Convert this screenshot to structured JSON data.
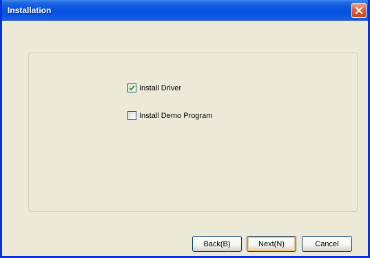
{
  "window": {
    "title": "Installation",
    "close_icon": "close-icon"
  },
  "options": [
    {
      "label": "Install Driver",
      "checked": true
    },
    {
      "label": "Install Demo Program",
      "checked": false
    }
  ],
  "buttons": {
    "back": "Back(B)",
    "next": "Next(N)",
    "cancel": "Cancel"
  },
  "colors": {
    "titlebar": "#0a54e3",
    "window_bg": "#ece9d8",
    "close_button": "#e0613c",
    "checkmark": "#21a121"
  }
}
